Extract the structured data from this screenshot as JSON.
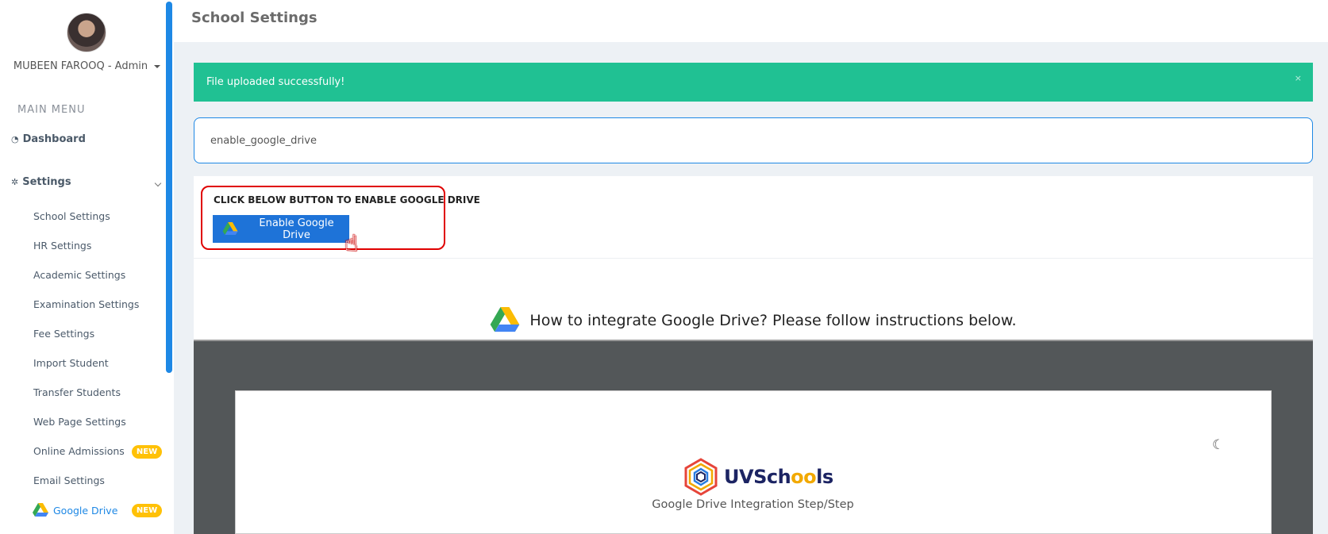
{
  "user": {
    "name": "MUBEEN FAROOQ - Admin"
  },
  "sidebar": {
    "heading": "MAIN MENU",
    "dashboard": "Dashboard",
    "settings": "Settings",
    "items": [
      {
        "label": "School Settings"
      },
      {
        "label": "HR Settings"
      },
      {
        "label": "Academic Settings"
      },
      {
        "label": "Examination Settings"
      },
      {
        "label": "Fee Settings"
      },
      {
        "label": "Import Student"
      },
      {
        "label": "Transfer Students"
      },
      {
        "label": "Web Page Settings"
      },
      {
        "label": "Online Admissions",
        "badge": "NEW"
      },
      {
        "label": "Email Settings"
      },
      {
        "label": "Google Drive",
        "badge": "NEW",
        "active": true
      }
    ]
  },
  "header": {
    "title": "School Settings"
  },
  "alert": {
    "message": "File uploaded successfully!",
    "close": "×"
  },
  "key_field": {
    "value": "enable_google_drive"
  },
  "enable_section": {
    "label": "CLICK BELOW BUTTON TO ENABLE GOOGLE DRIVE",
    "button": "Enable Google Drive"
  },
  "instructions": {
    "text": "How to integrate Google Drive? Please follow instructions below."
  },
  "video": {
    "logo_prefix": "UV",
    "logo_mid": "Sch",
    "logo_oo": "oo",
    "logo_suffix": "ls",
    "caption": "Google Drive Integration Step/Step"
  },
  "colors": {
    "accent": "#1e88e5",
    "success": "#20c193",
    "badge": "#ffc107",
    "highlight": "#e00000"
  },
  "icons": [
    "dashboard-icon",
    "gear-icon",
    "google-drive-icon",
    "moon-icon",
    "hand-cursor-icon"
  ]
}
